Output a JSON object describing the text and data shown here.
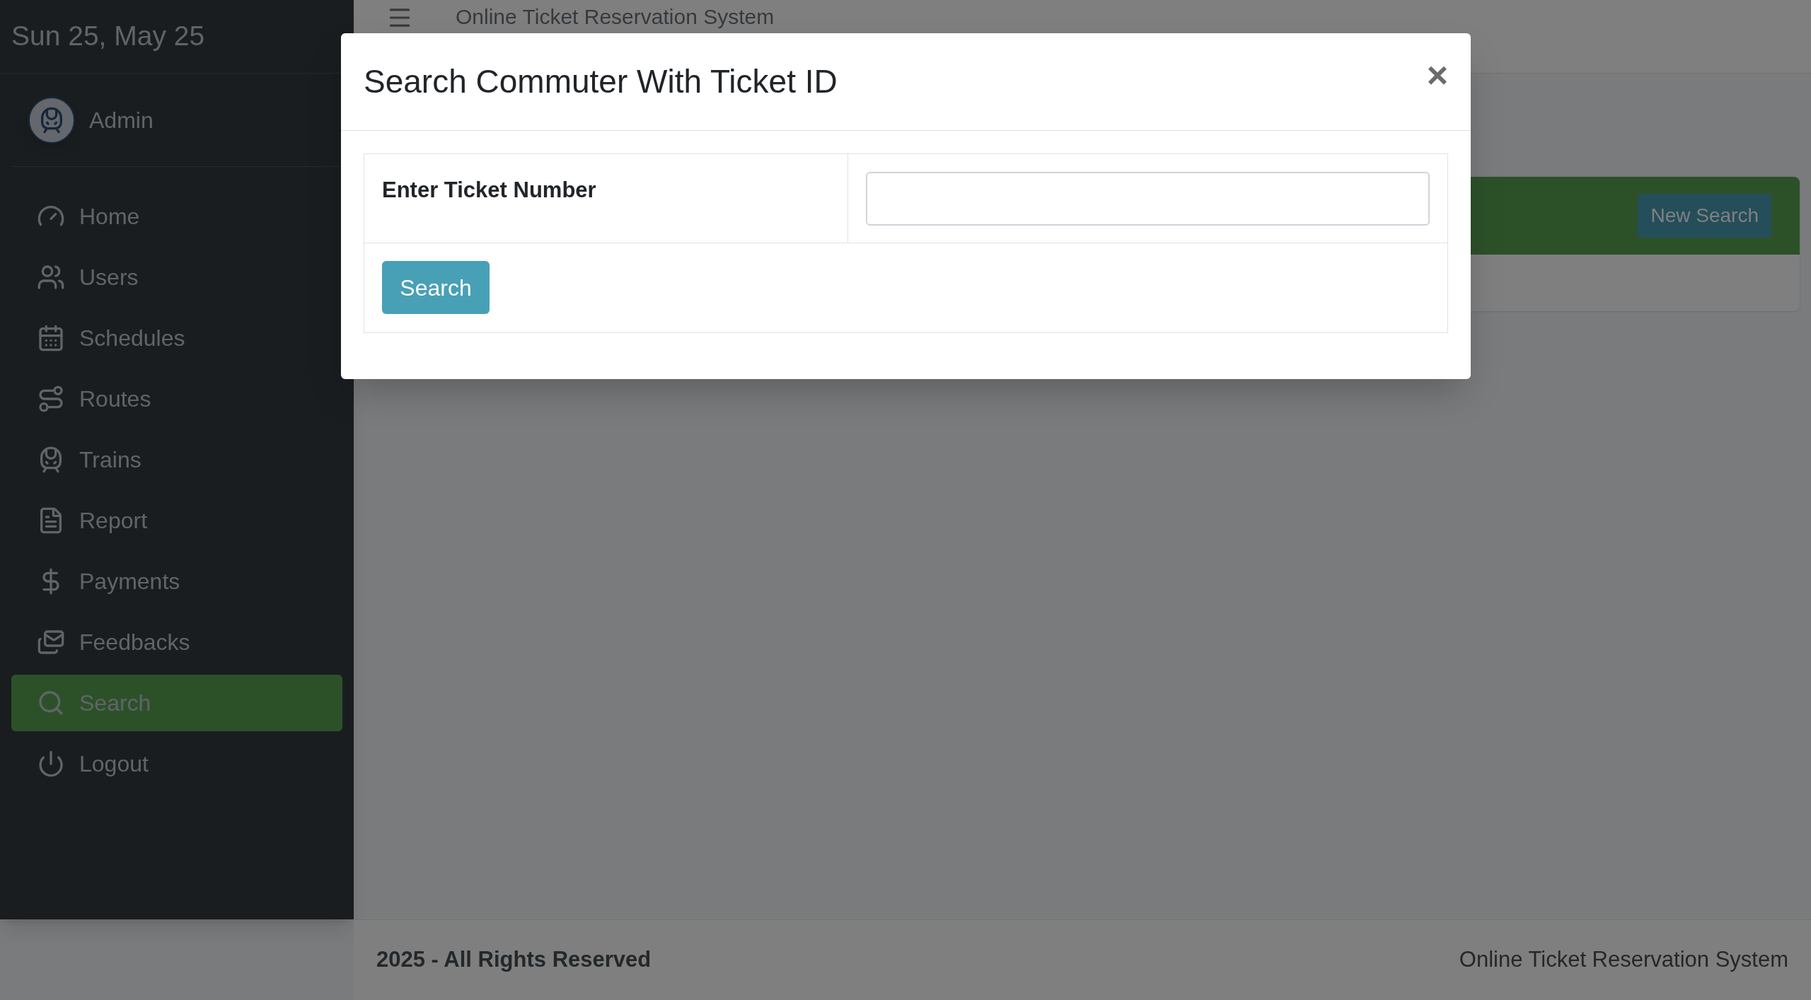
{
  "sidebar": {
    "date": "Sun 25, May 25",
    "user": {
      "name": "Admin"
    },
    "items": [
      {
        "label": "Home",
        "selected": false
      },
      {
        "label": "Users",
        "selected": false
      },
      {
        "label": "Schedules",
        "selected": false
      },
      {
        "label": "Routes",
        "selected": false
      },
      {
        "label": "Trains",
        "selected": false
      },
      {
        "label": "Report",
        "selected": false
      },
      {
        "label": "Payments",
        "selected": false
      },
      {
        "label": "Feedbacks",
        "selected": false
      },
      {
        "label": "Search",
        "selected": true
      },
      {
        "label": "Logout",
        "selected": false
      }
    ]
  },
  "header": {
    "title": "Online Ticket Reservation System"
  },
  "card": {
    "button": "New Search"
  },
  "modal": {
    "title": "Search Commuter With Ticket ID",
    "close": "×",
    "field_label": "Enter Ticket Number",
    "button": "Search"
  },
  "footer": {
    "left": "2025 - All Rights Reserved",
    "right": "Online Ticket Reservation System"
  }
}
